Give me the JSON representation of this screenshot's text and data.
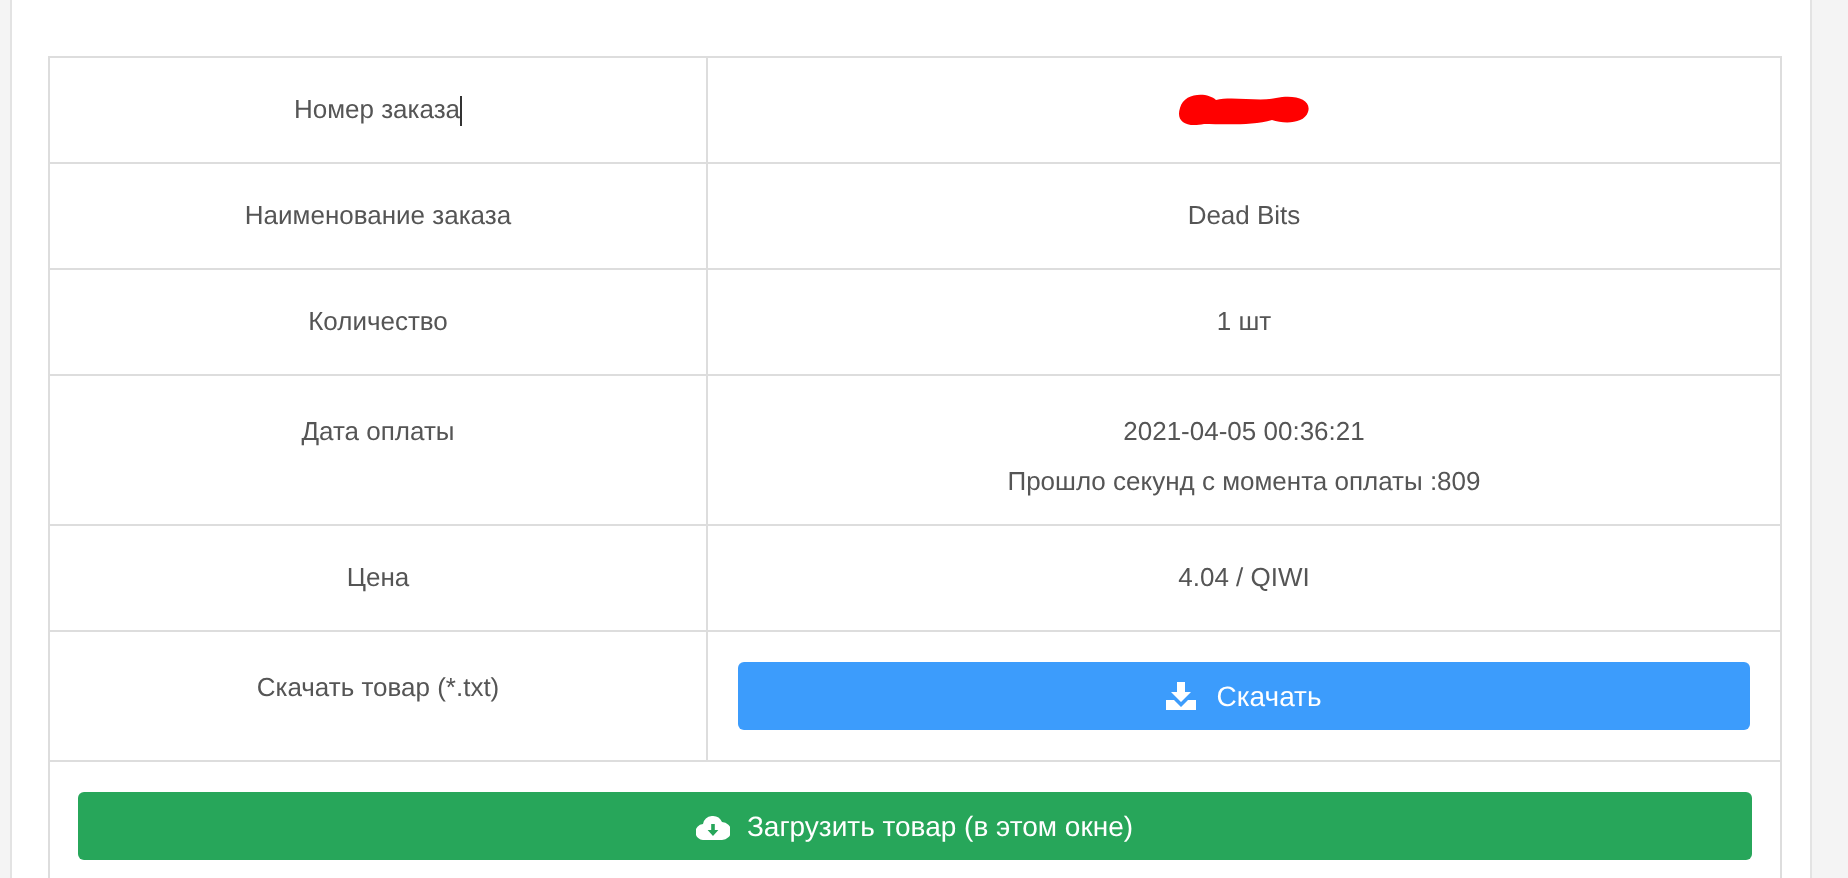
{
  "order_table": {
    "rows": [
      {
        "label": "Номер заказа",
        "text_cursor": true,
        "value": {
          "kind": "redacted"
        }
      },
      {
        "label": "Наименование заказа",
        "value": {
          "kind": "text",
          "lines": [
            "Dead Bits"
          ]
        }
      },
      {
        "label": "Количество",
        "value": {
          "kind": "text",
          "lines": [
            "1 шт"
          ]
        }
      },
      {
        "label": "Дата оплаты",
        "value": {
          "kind": "text",
          "lines": [
            "2021-04-05 00:36:21",
            "Прошло секунд с момента оплаты :809"
          ]
        }
      },
      {
        "label": "Цена",
        "value": {
          "kind": "text",
          "lines": [
            "4.04 / QIWI"
          ]
        }
      },
      {
        "label": "Скачать товар (*.txt)",
        "value": {
          "kind": "button",
          "label": "Скачать"
        }
      }
    ]
  },
  "upload_button": {
    "label": "Загрузить товар (в этом окне)"
  }
}
